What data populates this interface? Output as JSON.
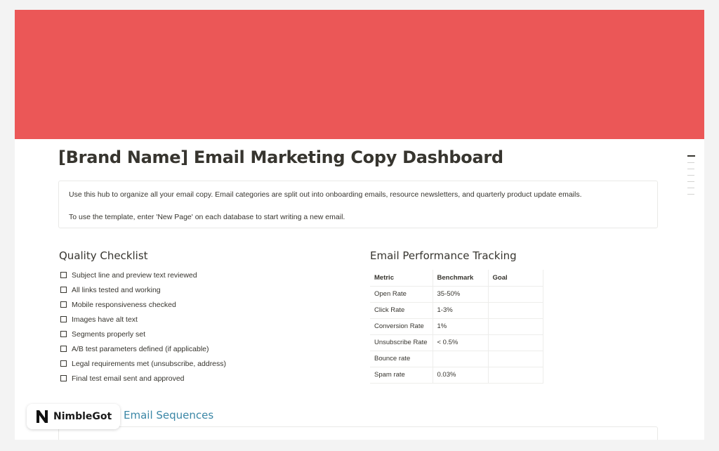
{
  "colors": {
    "cover": "#eb5757",
    "sequences_heading": "#3b87a6"
  },
  "page": {
    "title": "[Brand Name] Email Marketing Copy Dashboard"
  },
  "callout": {
    "line1": "Use this hub to organize all your email copy. Email categories are split out into onboarding emails, resource newsletters, and quarterly product update emails.",
    "line2": "To use the template, enter 'New Page' on each database to start writing a new email."
  },
  "quality_checklist": {
    "heading": "Quality Checklist",
    "items": [
      {
        "label": "Subject line and preview text reviewed",
        "checked": false
      },
      {
        "label": "All links tested and working",
        "checked": false
      },
      {
        "label": "Mobile responsiveness checked",
        "checked": false
      },
      {
        "label": "Images have alt text",
        "checked": false
      },
      {
        "label": "Segments properly set",
        "checked": false
      },
      {
        "label": "A/B test parameters defined (if applicable)",
        "checked": false
      },
      {
        "label": "Legal requirements met (unsubscribe, address)",
        "checked": false
      },
      {
        "label": "Final test email sent and approved",
        "checked": false
      }
    ]
  },
  "performance": {
    "heading": "Email Performance Tracking",
    "columns": [
      "Metric",
      "Benchmark",
      "Goal"
    ],
    "rows": [
      [
        "Open Rate",
        "35-50%",
        ""
      ],
      [
        "Click Rate",
        "1-3%",
        ""
      ],
      [
        "Conversion Rate",
        "1%",
        ""
      ],
      [
        "Unsubscribe Rate",
        "< 0.5%",
        ""
      ],
      [
        "Bounce rate",
        "",
        ""
      ],
      [
        "Spam rate",
        "0.03%",
        ""
      ]
    ]
  },
  "sequences": {
    "heading": "Email Sequences"
  },
  "watermark": {
    "brand": "NimbleGot",
    "icon": "n-logo-icon"
  }
}
